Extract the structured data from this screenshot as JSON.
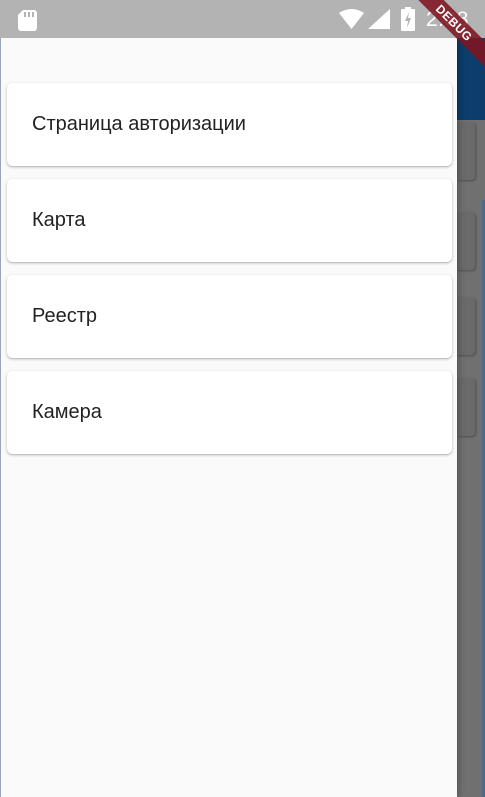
{
  "status_bar": {
    "time": "2:38",
    "icons": [
      "sd-card-icon",
      "wifi-icon",
      "cellular-signal-icon",
      "battery-charging-icon"
    ]
  },
  "debug_banner": {
    "label": "DEBUG"
  },
  "drawer": {
    "items": [
      {
        "label": "Страница авторизации"
      },
      {
        "label": "Карта"
      },
      {
        "label": "Реестр"
      },
      {
        "label": "Камера"
      }
    ]
  },
  "colors": {
    "status_bar": "#b3b3b3",
    "app_bar": "#0d3d6a",
    "debug_banner": "#801420",
    "drawer_background": "#fafafa",
    "card_background": "#ffffff",
    "scrim": "#707070"
  }
}
